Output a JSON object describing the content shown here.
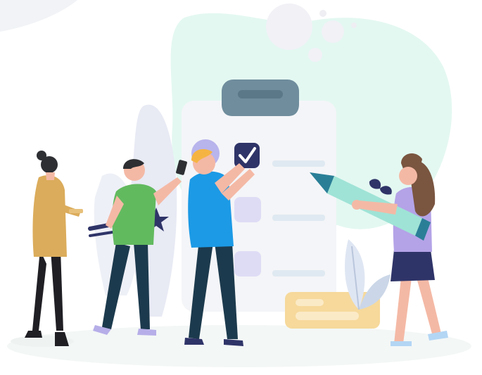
{
  "illustration": {
    "subject": "team-checklist",
    "colors": {
      "background_blob": "#e3f8f1",
      "floor_shadow": "#f3f7f6",
      "clipboard": "#f4f5f8",
      "clip": "#6f8d9d",
      "check_box_dark": "#2f3468",
      "check_box_light": "#dedcf5",
      "list_line": "#dfe9f1",
      "pencil_body": "#9fe3d6",
      "pencil_tip": "#2a7f97",
      "folder": "#f6d99b",
      "person_yellow": "#dbac5b",
      "person_green": "#62ba5f",
      "person_blue": "#1c9ae6",
      "person_purple": "#b4a3e7",
      "pants_dark": "#1c3a4d"
    },
    "icons": [
      "checkmark-icon",
      "star-icon",
      "leaf-icon",
      "pencil-icon",
      "clipboard-icon",
      "phone-icon"
    ]
  }
}
